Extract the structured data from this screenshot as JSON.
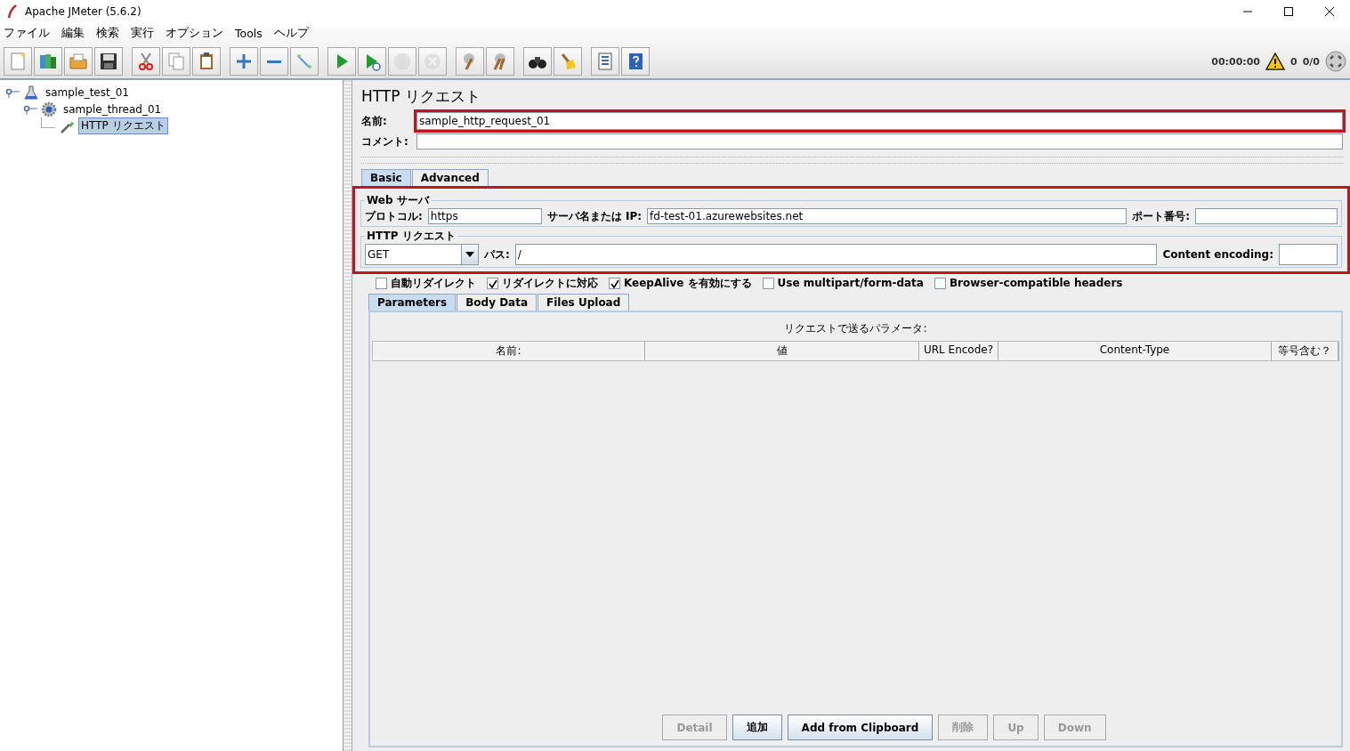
{
  "window": {
    "title": "Apache JMeter (5.6.2)"
  },
  "menu": [
    "ファイル",
    "編集",
    "検索",
    "実行",
    "オプション",
    "Tools",
    "ヘルプ"
  ],
  "toolbar": {
    "groups": [
      [
        {
          "kind": "new",
          "disabled": false
        },
        {
          "kind": "templates",
          "disabled": false
        },
        {
          "kind": "open",
          "disabled": false
        },
        {
          "kind": "save",
          "disabled": false
        }
      ],
      [
        {
          "kind": "cut",
          "disabled": false
        },
        {
          "kind": "copy",
          "disabled": false
        },
        {
          "kind": "paste",
          "disabled": false
        }
      ],
      [
        {
          "kind": "expand",
          "disabled": false
        },
        {
          "kind": "collapse",
          "disabled": false
        },
        {
          "kind": "toggle",
          "disabled": false
        }
      ],
      [
        {
          "kind": "start",
          "disabled": false
        },
        {
          "kind": "start-no-timers",
          "disabled": false
        },
        {
          "kind": "stop",
          "disabled": true
        },
        {
          "kind": "shutdown",
          "disabled": true
        }
      ],
      [
        {
          "kind": "clear",
          "disabled": false
        },
        {
          "kind": "clear-all",
          "disabled": false
        }
      ],
      [
        {
          "kind": "search",
          "disabled": false
        },
        {
          "kind": "reset-search",
          "disabled": false
        }
      ],
      [
        {
          "kind": "functions",
          "disabled": false
        },
        {
          "kind": "help",
          "disabled": false
        }
      ]
    ],
    "timer": "00:00:00",
    "warnings": "0",
    "threads": "0/0"
  },
  "tree": [
    {
      "label": "sample_test_01",
      "kind": "test-plan",
      "selected": false,
      "children": [
        {
          "label": "sample_thread_01",
          "kind": "thread-group",
          "selected": false,
          "children": [
            {
              "label": "HTTP リクエスト",
              "kind": "sampler",
              "selected": true
            }
          ]
        }
      ]
    }
  ],
  "editor": {
    "title": "HTTP リクエスト",
    "name": {
      "label": "名前:",
      "value": "sample_http_request_01",
      "highlighted": true
    },
    "comment": {
      "label": "コメント:"
    },
    "tabs": [
      {
        "label": "Basic",
        "selected": true
      },
      {
        "label": "Advanced",
        "selected": false
      }
    ],
    "request_box": {
      "highlighted": true,
      "web_server": {
        "title": "Web サーバ",
        "protocol_label": "プロトコル:",
        "protocol": "https",
        "server_label": "サーバ名または IP:",
        "server": "fd-test-01.azurewebsites.net",
        "port_label": "ポート番号:"
      },
      "http_request": {
        "title": "HTTP リクエスト",
        "method": "GET",
        "path_label": "パス:",
        "path": "/",
        "encoding_label": "Content encoding:"
      }
    },
    "options": [
      {
        "label": "自動リダイレクト",
        "checked": false
      },
      {
        "label": "リダイレクトに対応",
        "checked": true
      },
      {
        "label": "KeepAlive を有効にする",
        "checked": true
      },
      {
        "label": "Use multipart/form-data",
        "checked": false
      },
      {
        "label": "Browser-compatible headers",
        "checked": false
      }
    ],
    "sub_tabs": [
      {
        "label": "Parameters",
        "selected": true
      },
      {
        "label": "Body Data",
        "selected": false
      },
      {
        "label": "Files Upload",
        "selected": false
      }
    ],
    "table": {
      "caption": "リクエストで送るパラメータ:",
      "columns": [
        "名前:",
        "値",
        "URL Encode?",
        "Content-Type",
        "等号含む？"
      ]
    },
    "buttons": [
      {
        "label": "Detail",
        "disabled": true
      },
      {
        "label": "追加",
        "disabled": false
      },
      {
        "label": "Add from Clipboard",
        "disabled": false
      },
      {
        "label": "削除",
        "disabled": true
      },
      {
        "label": "Up",
        "disabled": true
      },
      {
        "label": "Down",
        "disabled": true
      }
    ]
  }
}
